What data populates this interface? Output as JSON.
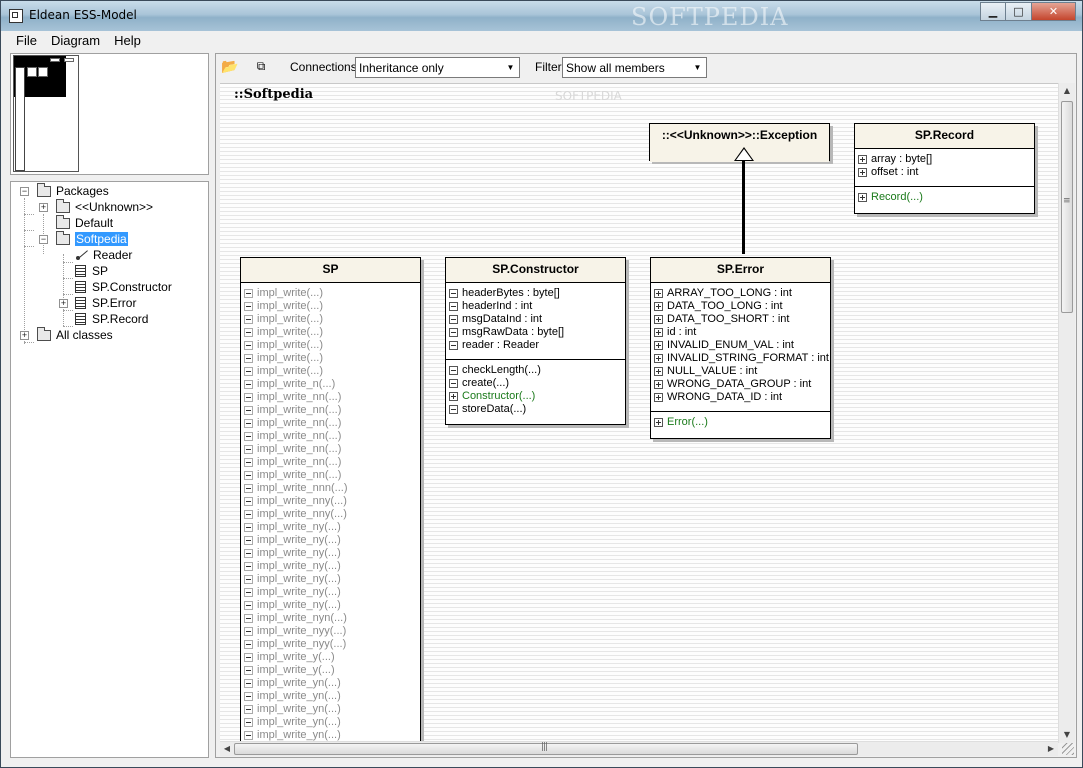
{
  "window": {
    "title": "Eldean ESS-Model",
    "watermark": "SOFTPEDIA",
    "minimize": "▁",
    "maximize": "□",
    "close": "✕"
  },
  "menu": [
    "File",
    "Diagram",
    "Help"
  ],
  "tree": {
    "root": "Packages",
    "unknown": "<<Unknown>>",
    "default": "Default",
    "softpedia": "Softpedia",
    "children": [
      "Reader",
      "SP",
      "SP.Constructor",
      "SP.Error",
      "SP.Record"
    ],
    "all_classes": "All classes"
  },
  "toolbar": {
    "connections_label": "Connections",
    "connections_value": "Inheritance only",
    "filter_label": "Filter",
    "filter_value": "Show all members"
  },
  "canvas": {
    "package_title": "::Softpedia",
    "watermark": "SOFTPEDIA"
  },
  "classes": {
    "exception": {
      "name": "::<<Unknown>>::Exception"
    },
    "record": {
      "name": "SP.Record",
      "fields": [
        "array : byte[]",
        "offset : int"
      ],
      "methods": [
        "Record(...)"
      ]
    },
    "sp": {
      "name": "SP",
      "methods": [
        "impl_write(...)",
        "impl_write(...)",
        "impl_write(...)",
        "impl_write(...)",
        "impl_write(...)",
        "impl_write(...)",
        "impl_write(...)",
        "impl_write_n(...)",
        "impl_write_nn(...)",
        "impl_write_nn(...)",
        "impl_write_nn(...)",
        "impl_write_nn(...)",
        "impl_write_nn(...)",
        "impl_write_nn(...)",
        "impl_write_nn(...)",
        "impl_write_nnn(...)",
        "impl_write_nny(...)",
        "impl_write_nny(...)",
        "impl_write_ny(...)",
        "impl_write_ny(...)",
        "impl_write_ny(...)",
        "impl_write_ny(...)",
        "impl_write_ny(...)",
        "impl_write_ny(...)",
        "impl_write_ny(...)",
        "impl_write_nyn(...)",
        "impl_write_nyy(...)",
        "impl_write_nyy(...)",
        "impl_write_y(...)",
        "impl_write_y(...)",
        "impl_write_yn(...)",
        "impl_write_yn(...)",
        "impl_write_yn(...)",
        "impl_write_yn(...)",
        "impl_write_yn(...)"
      ]
    },
    "constructor": {
      "name": "SP.Constructor",
      "fields": [
        "headerBytes : byte[]",
        "headerInd : int",
        "msgDataInd : int",
        "msgRawData : byte[]",
        "reader : Reader"
      ],
      "methods": [
        "checkLength(...)",
        "create(...)",
        "Constructor(...)",
        "storeData(...)"
      ]
    },
    "error": {
      "name": "SP.Error",
      "fields": [
        "ARRAY_TOO_LONG : int",
        "DATA_TOO_LONG : int",
        "DATA_TOO_SHORT : int",
        "id : int",
        "INVALID_ENUM_VAL : int",
        "INVALID_STRING_FORMAT : int",
        "NULL_VALUE : int",
        "WRONG_DATA_GROUP : int",
        "WRONG_DATA_ID : int"
      ],
      "methods": [
        "Error(...)"
      ]
    }
  },
  "icons": {
    "open": "open-folder-icon",
    "layout": "diagram-layout-icon"
  },
  "colors": {
    "class_header": "#f7f3e8",
    "selection": "#3399ff",
    "constructor_text": "#1a7a1a",
    "inherited_text": "#8a8a8a"
  }
}
